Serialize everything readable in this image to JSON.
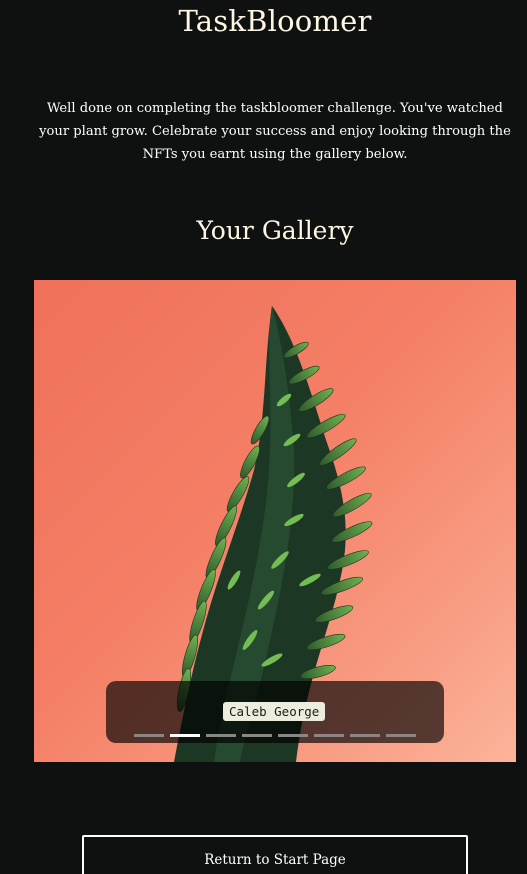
{
  "app": {
    "title": "TaskBloomer"
  },
  "intro": {
    "text": "Well done on completing the taskbloomer challenge. You've watched your plant grow. Celebrate your success and enjoy looking through the NFTs you earnt using the gallery below."
  },
  "gallery": {
    "heading": "Your Gallery",
    "current_caption": "Caleb George",
    "slide_count": 8,
    "active_slide_index": 1,
    "image_semantic": "plant-photo-nft",
    "colors": {
      "background": "#f47f66",
      "foliage_dark": "#1f3d2a",
      "foliage_light": "#5fa446"
    }
  },
  "actions": {
    "return_label": "Return to Start Page"
  },
  "colors": {
    "page_background": "#0f1111",
    "heading_text": "#fff6e3",
    "body_text": "#ffffff"
  }
}
